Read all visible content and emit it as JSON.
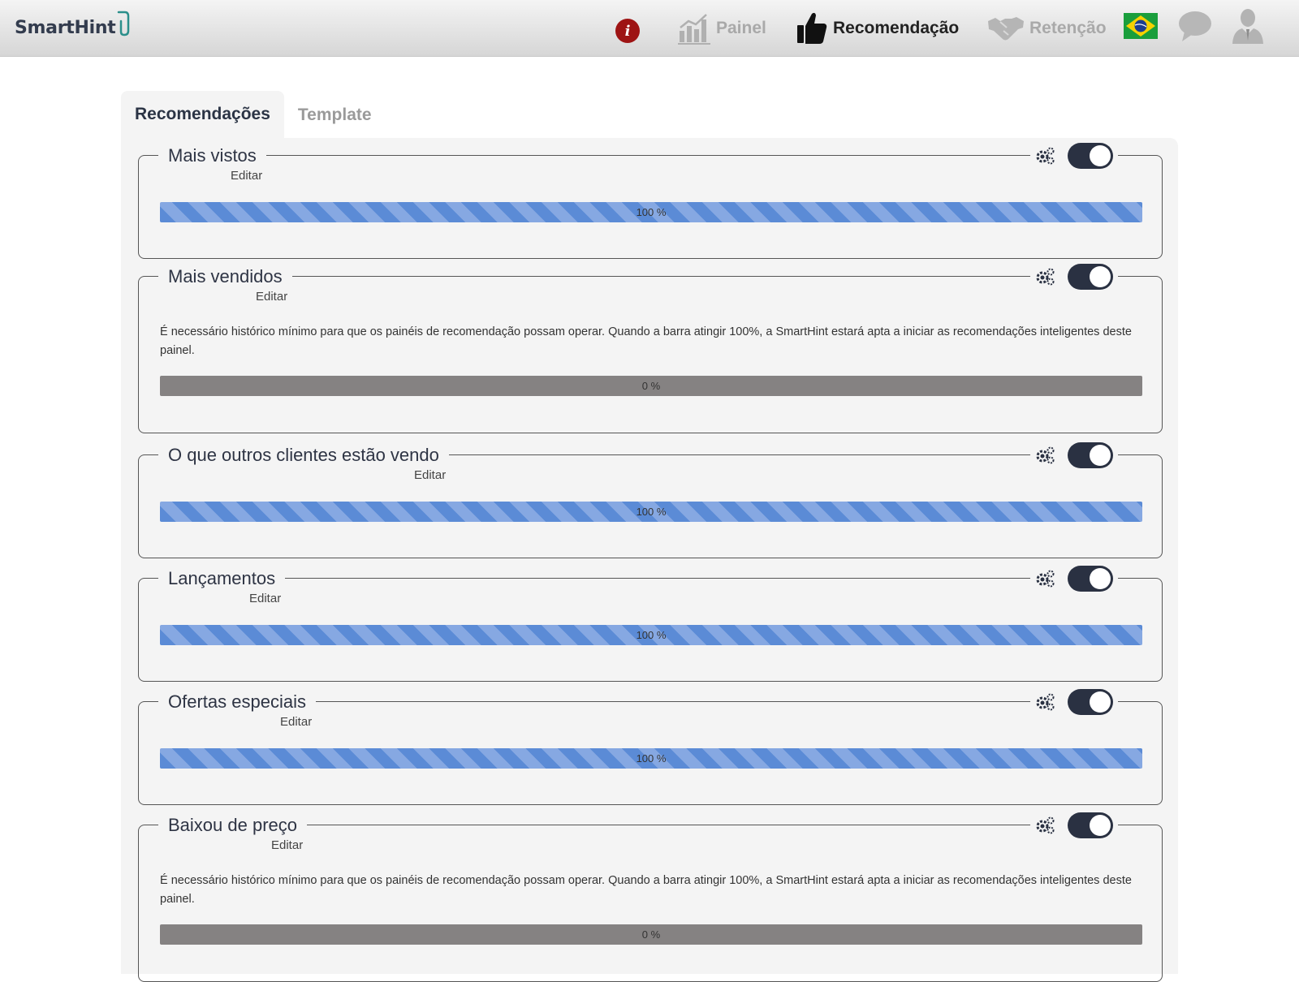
{
  "header": {
    "logo_text": "SmartHint",
    "info_label": "i",
    "nav": {
      "painel": "Painel",
      "recomendacao": "Recomendação",
      "retencao": "Retenção"
    },
    "icons": {
      "info": "info-icon",
      "painel": "bar-chart-icon",
      "recomendacao": "thumbs-up-icon",
      "retencao": "handshake-icon",
      "flag": "brazil-flag-icon",
      "chat": "chat-bubble-icon",
      "user": "user-icon"
    },
    "colors": {
      "info_bg": "#9e1414",
      "active_nav": "#222222",
      "inactive_nav": "#a9a9a9"
    }
  },
  "tabs": [
    {
      "label": "Recomendações",
      "active": true
    },
    {
      "label": "Template",
      "active": false
    }
  ],
  "notice_text": "É necessário histórico mínimo para que os painéis de recomendação possam operar. Quando a barra atingir 100%, a SmartHint estará apta a iniciar as recomendações inteligentes deste painel.",
  "edit_label": "Editar",
  "cards": [
    {
      "title": "Mais vistos",
      "progress": 100,
      "progress_label": "100 %",
      "enabled": true,
      "show_notice": false
    },
    {
      "title": "Mais vendidos",
      "progress": 0,
      "progress_label": "0 %",
      "enabled": true,
      "show_notice": true
    },
    {
      "title": "O que outros clientes estão vendo",
      "progress": 100,
      "progress_label": "100 %",
      "enabled": true,
      "show_notice": false
    },
    {
      "title": "Lançamentos",
      "progress": 100,
      "progress_label": "100 %",
      "enabled": true,
      "show_notice": false
    },
    {
      "title": "Ofertas especiais",
      "progress": 100,
      "progress_label": "100 %",
      "enabled": true,
      "show_notice": false
    },
    {
      "title": "Baixou de preço",
      "progress": 0,
      "progress_label": "0 %",
      "enabled": true,
      "show_notice": true
    }
  ]
}
